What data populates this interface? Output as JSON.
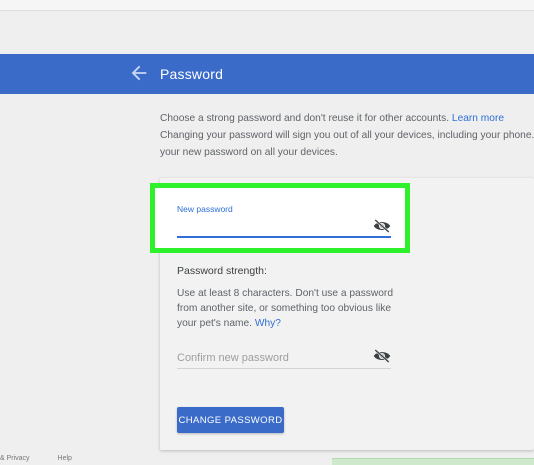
{
  "header": {
    "title": "Password"
  },
  "intro": {
    "line1": "Choose a strong password and don't reuse it for other accounts.",
    "learn_more": "Learn more",
    "line2": "Changing your password will sign you out of all your devices, including your phone. You will need to enter",
    "line3": "your new password on all your devices."
  },
  "form": {
    "new_password_label": "New password",
    "new_password_value": "",
    "strength_label": "Password strength:",
    "hint": "Use at least 8 characters. Don't use a password from another site, or something too obvious like your pet's name.",
    "why_link": "Why?",
    "confirm_placeholder": "Confirm new password",
    "submit_label": "CHANGE PASSWORD"
  },
  "footer": {
    "privacy": "& Privacy",
    "help": "Help"
  },
  "colors": {
    "accent": "#3a6bc9",
    "highlight": "#2ef12b",
    "link": "#2f6fd6"
  }
}
